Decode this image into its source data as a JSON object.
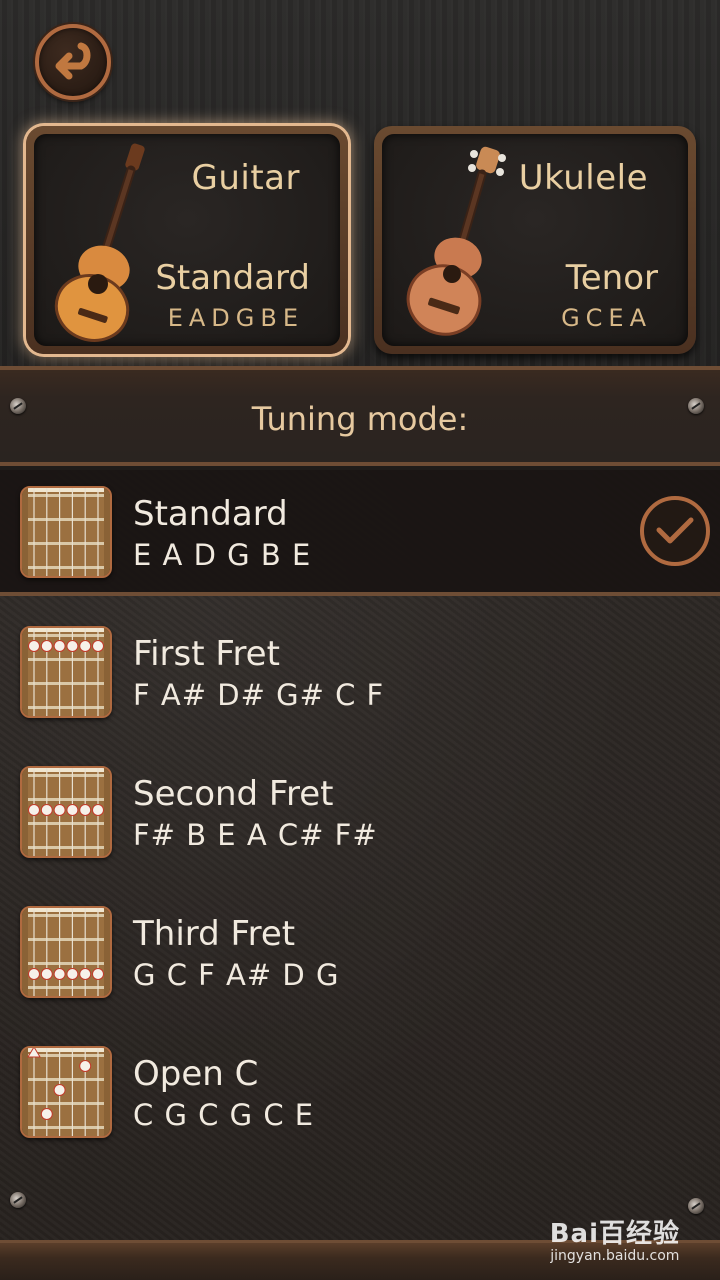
{
  "instruments": [
    {
      "name": "Guitar",
      "mode": "Standard",
      "notes": "EADGBE",
      "selected": true,
      "icon": "guitar-icon"
    },
    {
      "name": "Ukulele",
      "mode": "Tenor",
      "notes": "GCEA",
      "selected": false,
      "icon": "ukulele-icon"
    }
  ],
  "header": {
    "title": "Tuning mode:"
  },
  "tunings": [
    {
      "name": "Standard",
      "notes": "E A D G B E",
      "selected": true,
      "markers": []
    },
    {
      "name": "First Fret",
      "notes": "F A# D# G# C F",
      "selected": false,
      "markers": [
        1,
        1,
        1,
        1,
        1,
        1
      ]
    },
    {
      "name": "Second Fret",
      "notes": "F# B E A C# F#",
      "selected": false,
      "markers": [
        2,
        2,
        2,
        2,
        2,
        2
      ]
    },
    {
      "name": "Third Fret",
      "notes": "G C F A# D G",
      "selected": false,
      "markers": [
        3,
        3,
        3,
        3,
        3,
        3
      ]
    },
    {
      "name": "Open C",
      "notes": "C G C G C E",
      "selected": false,
      "markers": [
        0,
        3,
        2,
        0,
        1,
        0
      ]
    }
  ],
  "watermark": {
    "main": "Bai百经验",
    "sub": "jingyan.baidu.com"
  },
  "colors": {
    "accent": "#b06a40",
    "label": "#e9cfa2",
    "text": "#f1eadf"
  }
}
